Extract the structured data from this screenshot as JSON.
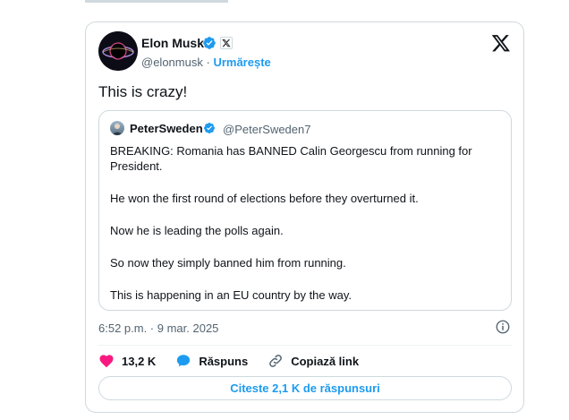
{
  "post": {
    "author_name": "Elon Musk",
    "handle": "@elonmusk",
    "separator": "·",
    "follow_label": "Urmărește",
    "text": "This is crazy!",
    "timestamp": "6:52 p.m. · 9 mar. 2025"
  },
  "quoted": {
    "author_name": "PeterSweden",
    "handle": "@PeterSweden7",
    "paragraphs": [
      "BREAKING: Romania has BANNED Calin Georgescu from running for President.",
      "He won the first round of elections before they overturned it.",
      "Now he is leading the polls again.",
      "So now they simply banned him from running.",
      "This is happening in an EU country by the way."
    ]
  },
  "actions": {
    "likes": "13,2 K",
    "reply_label": "Răspuns",
    "copy_link_label": "Copiază link",
    "read_replies_label": "Citeste 2,1 K de răspunsuri"
  },
  "colors": {
    "accent": "#1d9bf0",
    "like": "#f91880",
    "border": "#cfd9de",
    "muted_text": "#536471",
    "text": "#0f1419"
  },
  "icons": {
    "brand": "x-logo-icon",
    "verified": "verified-badge-icon",
    "affiliate": "x-affiliate-icon",
    "info": "info-icon",
    "like": "heart-icon",
    "reply": "speech-bubble-icon",
    "copy": "link-icon"
  }
}
